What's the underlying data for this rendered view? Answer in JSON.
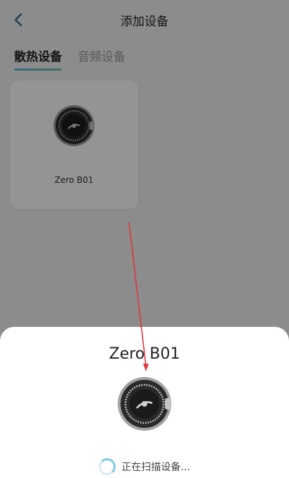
{
  "header": {
    "title": "添加设备",
    "back_icon": "chevron-left-icon"
  },
  "tabs": [
    {
      "label": "散热设备",
      "active": true
    },
    {
      "label": "音频设备",
      "active": false
    }
  ],
  "device_card": {
    "name": "Zero B01",
    "image_icon": "cooling-fan-device-icon"
  },
  "sheet": {
    "title": "Zero B01",
    "status": "正在扫描设备...",
    "spinner_icon": "loading-spinner-icon"
  },
  "colors": {
    "accent": "#59b6de",
    "accent2": "#72c2a9",
    "arrow": "#e0353a"
  }
}
